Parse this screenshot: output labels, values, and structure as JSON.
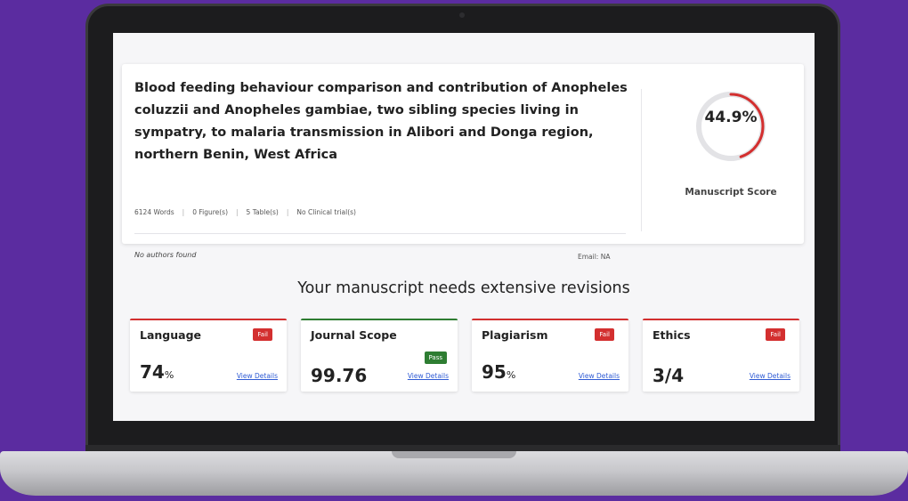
{
  "manuscript": {
    "title": "Blood feeding behaviour comparison and contribution of Anopheles coluzzii and Anopheles gambiae, two sibling species living in sympatry, to malaria transmission in Alibori and Donga region, northern Benin, West Africa",
    "words": "6124 Words",
    "figures": "0 Figure(s)",
    "tables": "5 Table(s)",
    "clinical": "No Clinical trial(s)",
    "authors": "No authors found",
    "email": "Email: NA"
  },
  "score": {
    "value": "44.9%",
    "fraction": 0.449,
    "label": "Manuscript Score",
    "color": "#d32f2f"
  },
  "headline": "Your manuscript needs extensive revisions",
  "metrics": [
    {
      "label": "Language",
      "status": "Fail",
      "value": "74",
      "unit": "%",
      "link": "View Details"
    },
    {
      "label": "Journal Scope",
      "status": "Pass",
      "value": "99.76",
      "unit": "",
      "link": "View Details"
    },
    {
      "label": "Plagiarism",
      "status": "Fail",
      "value": "95",
      "unit": "%",
      "link": "View Details"
    },
    {
      "label": "Ethics",
      "status": "Fail",
      "value": "3/4",
      "unit": "",
      "link": "View Details"
    }
  ],
  "colors": {
    "fail": "#d32f2f",
    "pass": "#2e7d32",
    "background": "#5b2ca0",
    "link": "#2f5bd4"
  }
}
